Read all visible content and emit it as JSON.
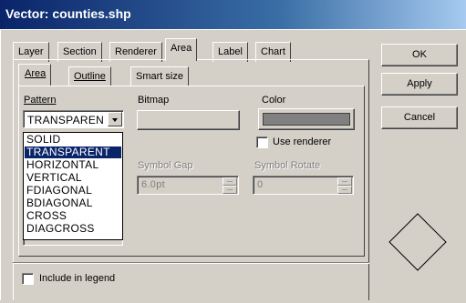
{
  "window": {
    "title": "Vector: counties.shp"
  },
  "tabs": [
    {
      "label": "Layer"
    },
    {
      "label": "Section"
    },
    {
      "label": "Renderer"
    },
    {
      "label": "Area"
    },
    {
      "label": "Label"
    },
    {
      "label": "Chart"
    }
  ],
  "active_tab": "Area",
  "subtabs": [
    {
      "label": "Area"
    },
    {
      "label": "Outline"
    },
    {
      "label": "Smart size"
    }
  ],
  "active_subtab": "Area",
  "pattern": {
    "label": "Pattern",
    "value": "TRANSPAREN",
    "options": [
      "SOLID",
      "TRANSPARENT",
      "HORIZONTAL",
      "VERTICAL",
      "FDIAGONAL",
      "BDIAGONAL",
      "CROSS",
      "DIAGCROSS"
    ],
    "selected": "TRANSPARENT"
  },
  "bitmap": {
    "label": "Bitmap"
  },
  "color": {
    "label": "Color",
    "value": "#808080"
  },
  "use_renderer": {
    "label": "Use renderer",
    "checked": false
  },
  "symbol_gap": {
    "label": "Symbol Gap",
    "value": "6.0pt"
  },
  "symbol_rotate": {
    "label": "Symbol Rotate",
    "value": "0"
  },
  "include_in_legend": {
    "label": "Include in legend",
    "checked": false
  },
  "buttons": {
    "ok": "OK",
    "apply": "Apply",
    "cancel": "Cancel"
  },
  "preview": {
    "icon": "diamond-icon"
  }
}
